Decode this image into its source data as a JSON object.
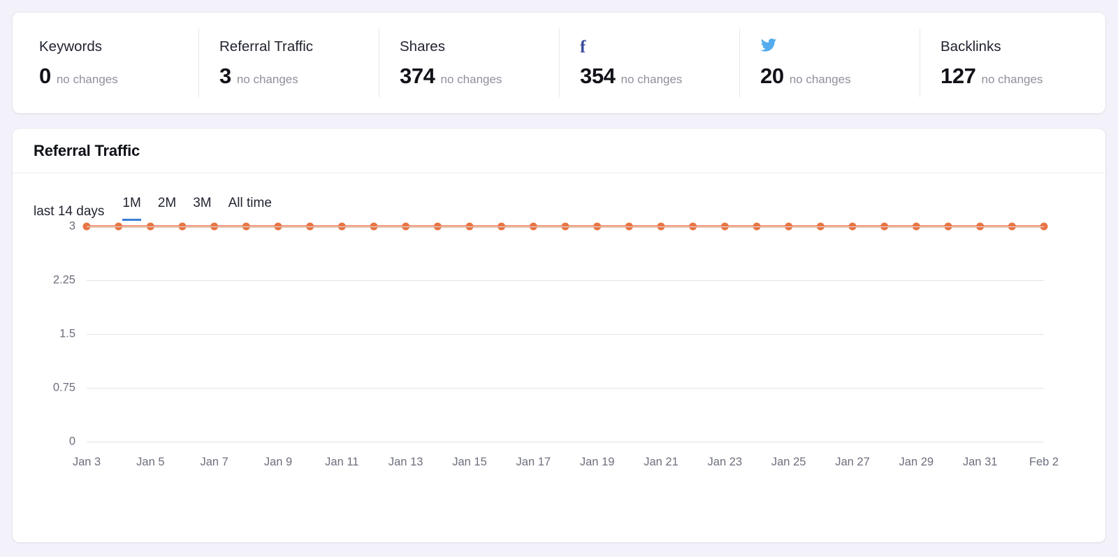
{
  "stats": {
    "items": [
      {
        "label": "Keywords",
        "icon": null,
        "value": "0",
        "delta": "no changes"
      },
      {
        "label": "Referral Traffic",
        "icon": null,
        "value": "3",
        "delta": "no changes"
      },
      {
        "label": "Shares",
        "icon": null,
        "value": "374",
        "delta": "no changes"
      },
      {
        "label": "",
        "icon": "facebook-icon",
        "value": "354",
        "delta": "no changes"
      },
      {
        "label": "",
        "icon": "twitter-icon",
        "value": "20",
        "delta": "no changes"
      },
      {
        "label": "Backlinks",
        "icon": null,
        "value": "127",
        "delta": "no changes"
      }
    ]
  },
  "chart_card": {
    "title": "Referral Traffic",
    "range_label": "last 14 days",
    "tabs": [
      {
        "label": "1M",
        "active": true
      },
      {
        "label": "2M",
        "active": false
      },
      {
        "label": "3M",
        "active": false
      },
      {
        "label": "All time",
        "active": false
      }
    ]
  },
  "colors": {
    "page_background": "#f3f2fa",
    "card_background": "#ffffff",
    "series_orange": "#e87544",
    "tab_active_blue": "#3b7fd4",
    "gridline": "#e3e3e8",
    "facebook_blue": "#3b4d9b",
    "twitter_blue": "#55acee",
    "axis_text": "#6d6f7d"
  },
  "chart_data": {
    "type": "line",
    "title": "Referral Traffic",
    "xlabel": "",
    "ylabel": "",
    "ylim": [
      0,
      3
    ],
    "yticks": [
      3,
      2.25,
      1.5,
      0.75,
      0
    ],
    "ytick_labels": [
      "3",
      "2.25",
      "1.5",
      "0.75",
      "0"
    ],
    "grid": true,
    "legend": null,
    "markers": true,
    "x": [
      "Jan 3",
      "Jan 4",
      "Jan 5",
      "Jan 6",
      "Jan 7",
      "Jan 8",
      "Jan 9",
      "Jan 10",
      "Jan 11",
      "Jan 12",
      "Jan 13",
      "Jan 14",
      "Jan 15",
      "Jan 16",
      "Jan 17",
      "Jan 18",
      "Jan 19",
      "Jan 20",
      "Jan 21",
      "Jan 22",
      "Jan 23",
      "Jan 24",
      "Jan 25",
      "Jan 26",
      "Jan 27",
      "Jan 28",
      "Jan 29",
      "Jan 30",
      "Jan 31",
      "Feb 1",
      "Feb 2"
    ],
    "xtick_labels": [
      "Jan 3",
      "Jan 5",
      "Jan 7",
      "Jan 9",
      "Jan 11",
      "Jan 13",
      "Jan 15",
      "Jan 17",
      "Jan 19",
      "Jan 21",
      "Jan 23",
      "Jan 25",
      "Jan 27",
      "Jan 29",
      "Jan 31",
      "Feb 2"
    ],
    "series": [
      {
        "name": "Referral Traffic",
        "color": "#e87544",
        "values": [
          3,
          3,
          3,
          3,
          3,
          3,
          3,
          3,
          3,
          3,
          3,
          3,
          3,
          3,
          3,
          3,
          3,
          3,
          3,
          3,
          3,
          3,
          3,
          3,
          3,
          3,
          3,
          3,
          3,
          3,
          3
        ]
      }
    ]
  }
}
